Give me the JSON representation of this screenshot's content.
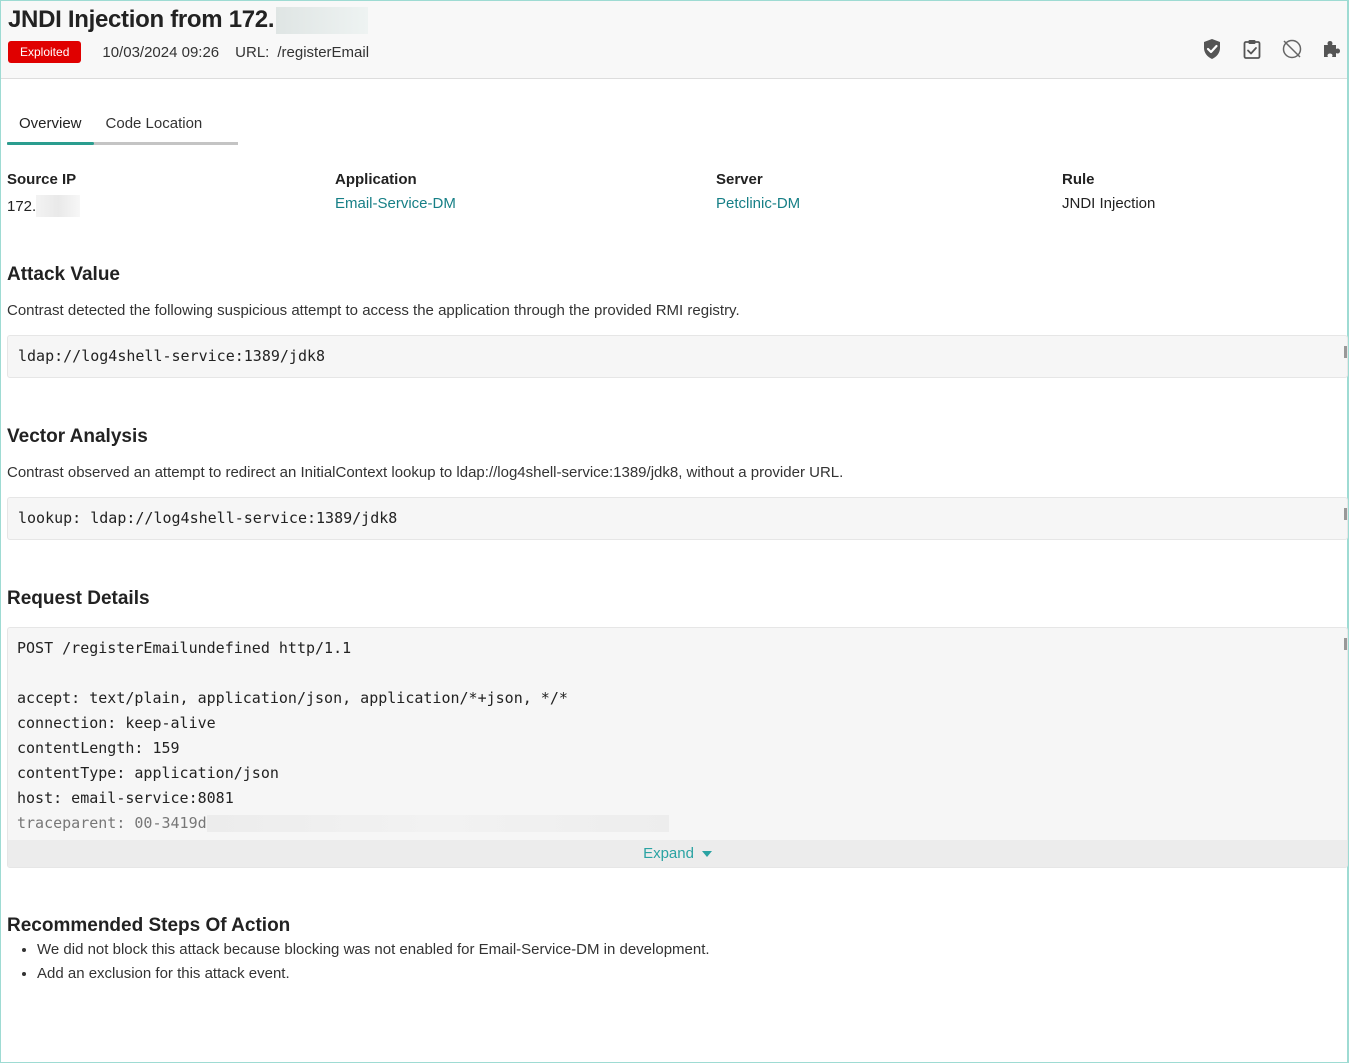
{
  "header": {
    "title": "JNDI Injection from 172.",
    "status_badge": "Exploited",
    "status_color": "#e00000",
    "datetime": "10/03/2024 09:26",
    "url_label": "URL:",
    "url_value": "/registerEmail",
    "actions": [
      {
        "icon": "shield-check-icon"
      },
      {
        "icon": "clipboard-check-icon"
      },
      {
        "icon": "not-allowed-icon"
      },
      {
        "icon": "puzzle-icon"
      }
    ]
  },
  "tabs": [
    {
      "label": "Overview",
      "active": true
    },
    {
      "label": "Code Location",
      "active": false
    }
  ],
  "info": {
    "source_ip": {
      "label": "Source IP",
      "value": "172."
    },
    "application": {
      "label": "Application",
      "value": "Email-Service-DM"
    },
    "server": {
      "label": "Server",
      "value": "Petclinic-DM"
    },
    "rule": {
      "label": "Rule",
      "value": "JNDI Injection"
    }
  },
  "attack_value": {
    "title": "Attack Value",
    "description": "Contrast detected the following suspicious attempt to access the application through the provided RMI registry.",
    "code": "ldap://log4shell-service:1389/jdk8"
  },
  "vector_analysis": {
    "title": "Vector Analysis",
    "description": "Contrast observed an attempt to redirect an InitialContext lookup to ldap://log4shell-service:1389/jdk8, without a provider URL.",
    "code": "lookup: ldap://log4shell-service:1389/jdk8"
  },
  "request_details": {
    "title": "Request Details",
    "lines": [
      "POST /registerEmailundefined http/1.1",
      "",
      "accept: text/plain, application/json, application/*+json, */*",
      "connection: keep-alive",
      "contentLength: 159",
      "contentType: application/json",
      "host: email-service:8081"
    ],
    "faded_line": "traceparent: 00-3419d",
    "expand_label": "Expand"
  },
  "recommended": {
    "title": "Recommended Steps Of Action",
    "steps": [
      "We did not block this attack because blocking was not enabled for Email-Service-DM in development.",
      "Add an exclusion for this attack event."
    ]
  }
}
